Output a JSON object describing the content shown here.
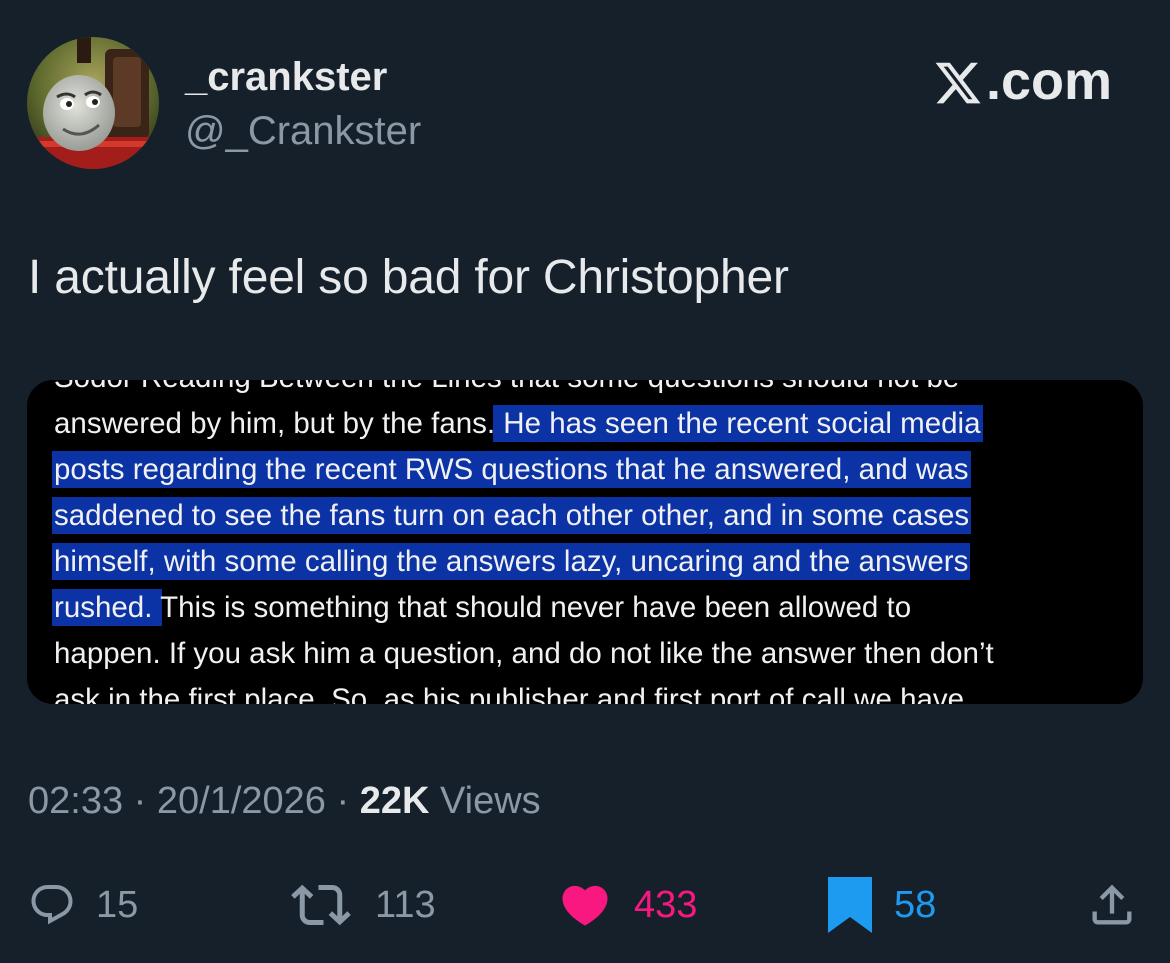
{
  "author": {
    "display_name": "_crankster",
    "handle": "@_Crankster"
  },
  "brand": {
    "label": ".com",
    "icon": "x-logo-icon"
  },
  "tweet": {
    "text": "I actually feel so bad for Christopher"
  },
  "media": {
    "lines": [
      {
        "plain": "Sodor Reading Between the Lines that some questions should not be",
        "highlight": "",
        "rest": ""
      },
      {
        "plain": "answered by him, but by the fans.",
        "highlight": " He has seen the recent social media ",
        "rest": ""
      },
      {
        "plain": "",
        "highlight": "posts regarding the recent RWS questions that he answered, and was ",
        "rest": ""
      },
      {
        "plain": "",
        "highlight": "saddened to see the fans turn on each other other, and in some cases ",
        "rest": ""
      },
      {
        "plain": "",
        "highlight": "himself, with some calling the answers lazy, uncaring and the answers ",
        "rest": ""
      },
      {
        "plain": "",
        "highlight": "rushed. ",
        "rest": "This is something that should never have been allowed to"
      },
      {
        "plain": "happen. If you ask him a question, and do not like the answer then don’t",
        "highlight": "",
        "rest": ""
      },
      {
        "plain": "ask in the first place. So, as his publisher and first port of call we have",
        "highlight": "",
        "rest": ""
      }
    ],
    "highlight_color": "#0b33a6"
  },
  "meta": {
    "time": "02:33",
    "sep1": " · ",
    "date": "20/1/2026",
    "sep2": " · ",
    "views_count": "22K",
    "views_label": " Views"
  },
  "actions": {
    "replies": {
      "icon": "reply-icon",
      "count": "15",
      "color": "#8b98a5"
    },
    "reposts": {
      "icon": "repost-icon",
      "count": "113",
      "color": "#8b98a5"
    },
    "likes": {
      "icon": "heart-icon",
      "count": "433",
      "color": "#f91880"
    },
    "bookmarks": {
      "icon": "bookmark-icon",
      "count": "58",
      "color": "#1d9bf0"
    },
    "share": {
      "icon": "share-icon"
    }
  }
}
